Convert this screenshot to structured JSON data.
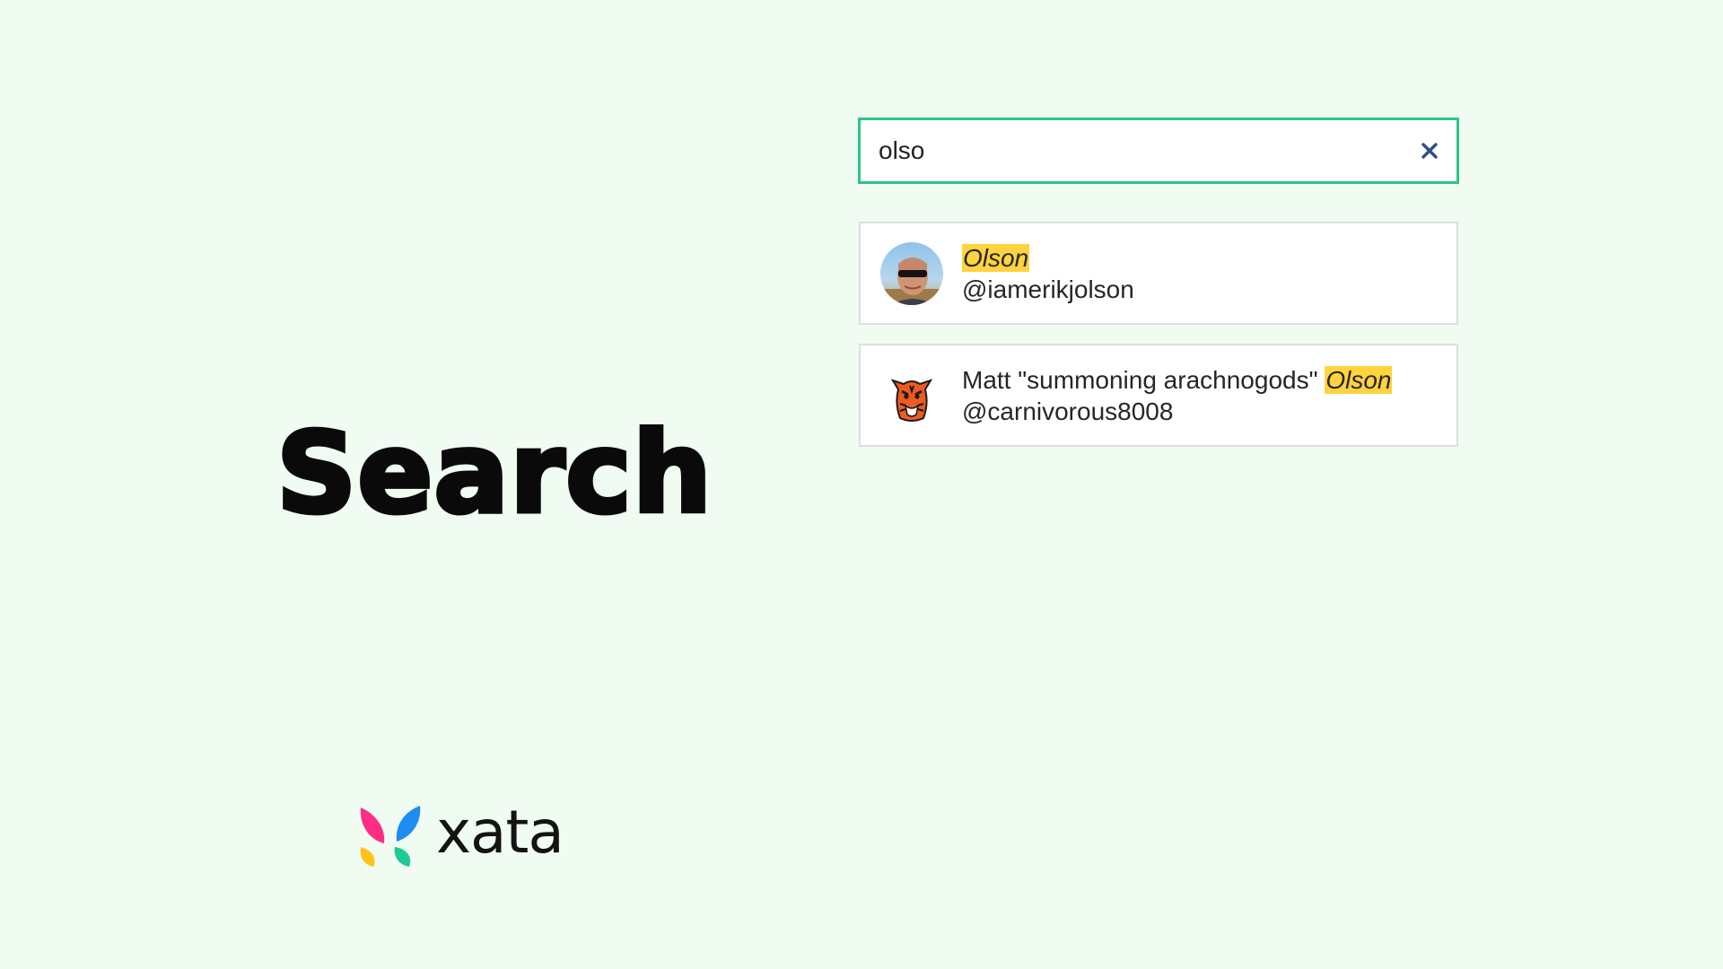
{
  "hero": {
    "title": "Search"
  },
  "brand": {
    "name": "xata"
  },
  "search": {
    "value": "olso",
    "placeholder": ""
  },
  "results": [
    {
      "name_prefix": "",
      "name_highlight": "Olson",
      "handle": "@iamerikjolson",
      "avatar": "person-sunglasses-avatar"
    },
    {
      "name_prefix": "Matt \"summoning arachnogods\" ",
      "name_highlight": "Olson",
      "handle": "@carnivorous8008",
      "avatar": "tiger-avatar"
    }
  ],
  "colors": {
    "background": "#f0fbf1",
    "search_border": "#2fc48c",
    "highlight": "#ffd33d",
    "clear_icon": "#2f4b8a"
  },
  "icons": {
    "clear": "close-icon"
  }
}
